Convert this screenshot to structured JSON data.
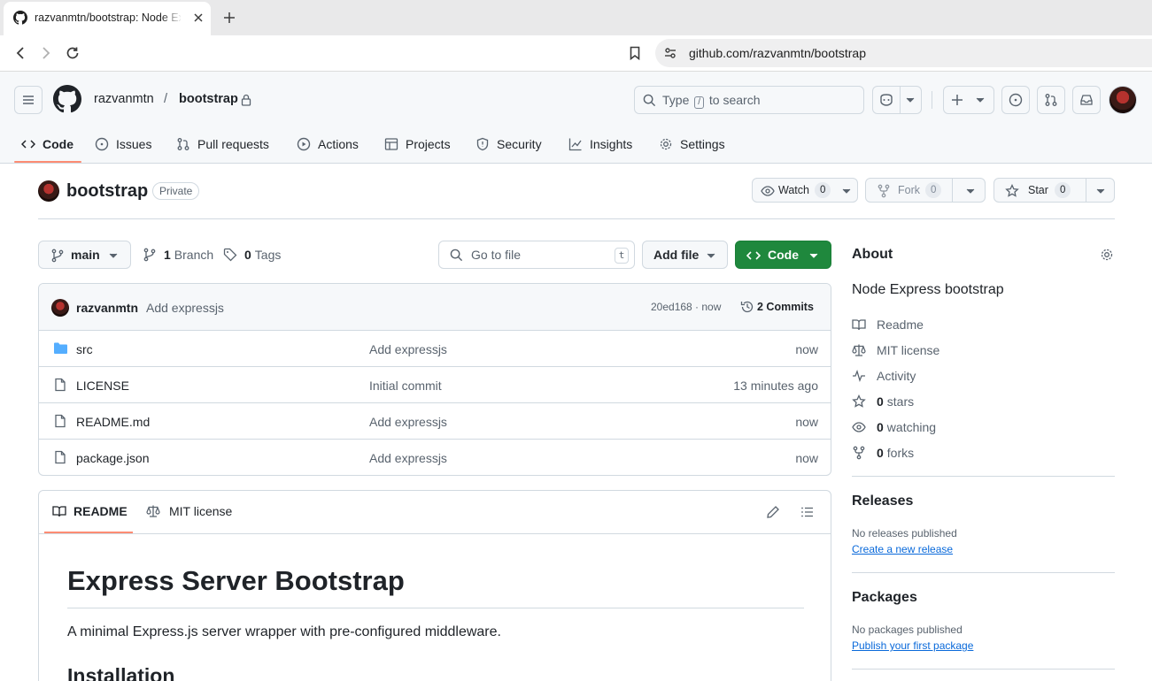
{
  "browser": {
    "tab_title": "razvanmtn/bootstrap: Node Express bootstrap",
    "url": "github.com/razvanmtn/bootstrap"
  },
  "header": {
    "owner": "razvanmtn",
    "separator": "/",
    "repo": "bootstrap",
    "search_prefix": "Type",
    "search_key": "/",
    "search_suffix": "to search"
  },
  "repo_nav": {
    "tabs": [
      {
        "label": "Code"
      },
      {
        "label": "Issues"
      },
      {
        "label": "Pull requests"
      },
      {
        "label": "Actions"
      },
      {
        "label": "Projects"
      },
      {
        "label": "Security"
      },
      {
        "label": "Insights"
      },
      {
        "label": "Settings"
      }
    ]
  },
  "repo_title": {
    "name": "bootstrap",
    "visibility": "Private",
    "watch_label": "Watch",
    "watch_count": "0",
    "fork_label": "Fork",
    "fork_count": "0",
    "star_label": "Star",
    "star_count": "0"
  },
  "branch_bar": {
    "branch": "main",
    "branch_count": "1",
    "branch_label": "Branch",
    "tag_count": "0",
    "tag_label": "Tags",
    "goto_placeholder": "Go to file",
    "goto_key": "t",
    "add_file": "Add file",
    "code": "Code"
  },
  "latest_commit": {
    "author": "razvanmtn",
    "message": "Add expressjs",
    "hash_time": "20ed168 · now",
    "commits": "2 Commits"
  },
  "files": [
    {
      "name": "src",
      "type": "folder",
      "message": "Add expressjs",
      "time": "now"
    },
    {
      "name": "LICENSE",
      "type": "file",
      "message": "Initial commit",
      "time": "13 minutes ago"
    },
    {
      "name": "README.md",
      "type": "file",
      "message": "Add expressjs",
      "time": "now"
    },
    {
      "name": "package.json",
      "type": "file",
      "message": "Add expressjs",
      "time": "now"
    }
  ],
  "readme": {
    "tab_readme": "README",
    "tab_license": "MIT license",
    "h1": "Express Server Bootstrap",
    "p": "A minimal Express.js server wrapper with pre-configured middleware.",
    "h2": "Installation"
  },
  "about": {
    "title": "About",
    "description": "Node Express bootstrap",
    "readme": "Readme",
    "license": "MIT license",
    "activity": "Activity",
    "stars_count": "0",
    "stars_label": "stars",
    "watching_count": "0",
    "watching_label": "watching",
    "forks_count": "0",
    "forks_label": "forks"
  },
  "releases": {
    "title": "Releases",
    "text": "No releases published",
    "link": "Create a new release"
  },
  "packages": {
    "title": "Packages",
    "text": "No packages published",
    "link": "Publish your first package"
  }
}
